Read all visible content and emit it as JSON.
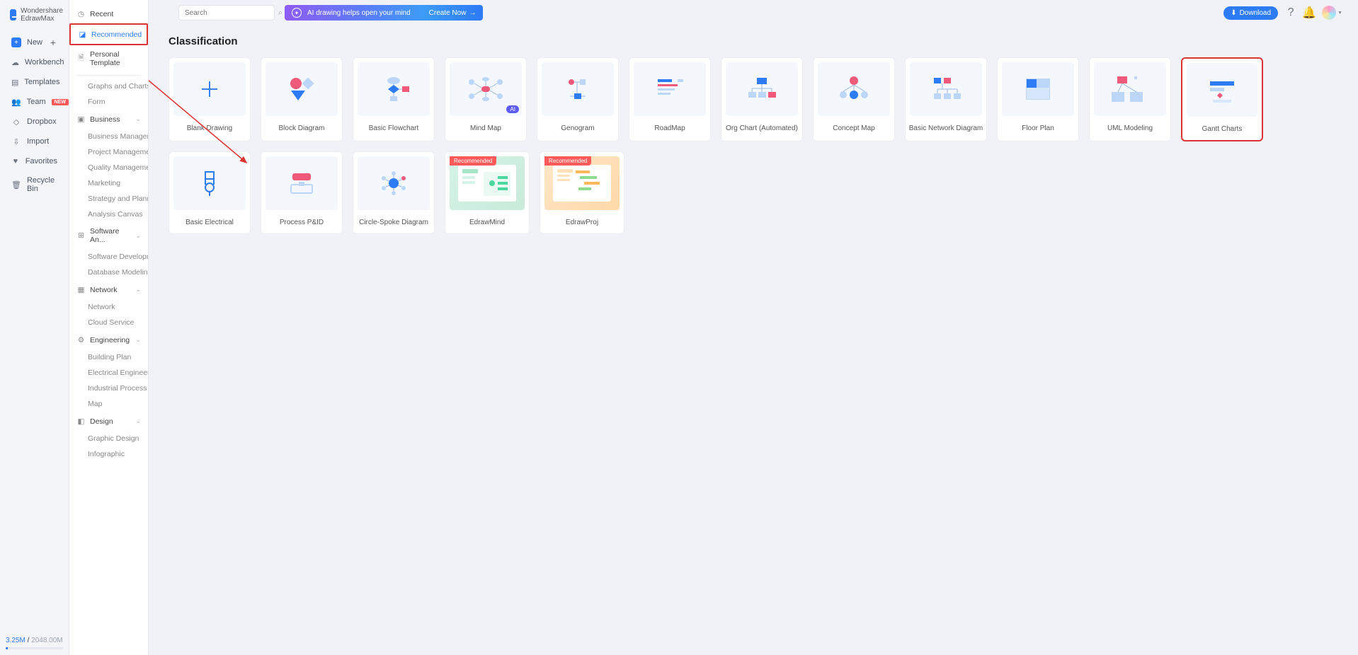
{
  "brand": {
    "line1": "Wondershare",
    "line2": "EdrawMax"
  },
  "leftNav": {
    "new": "New",
    "workbench": "Workbench",
    "templates": "Templates",
    "team": "Team",
    "team_badge": "NEW",
    "dropbox": "Dropbox",
    "import": "Import",
    "favorites": "Favorites",
    "recycle": "Recycle Bin"
  },
  "storage": {
    "used": "3.25M",
    "total_sep": " / ",
    "total": "2048.00M"
  },
  "midNav": {
    "recent": "Recent",
    "recommended": "Recommended",
    "personal": "Personal Template",
    "graphs": "Graphs and Charts",
    "form": "Form",
    "business": "Business",
    "business_sub": [
      "Business Management",
      "Project Management",
      "Quality Management",
      "Marketing",
      "Strategy and Planning",
      "Analysis Canvas"
    ],
    "software": "Software An...",
    "software_sub": [
      "Software Development",
      "Database Modeling"
    ],
    "network": "Network",
    "network_sub": [
      "Network",
      "Cloud Service"
    ],
    "engineering": "Engineering",
    "engineering_sub": [
      "Building Plan",
      "Electrical Engineering",
      "Industrial Process",
      "Map"
    ],
    "design": "Design",
    "design_sub": [
      "Graphic Design",
      "Infographic"
    ]
  },
  "header": {
    "search_placeholder": "Search",
    "ai_text": "AI drawing helps open your mind",
    "ai_create": "Create Now",
    "download": "Download"
  },
  "content": {
    "title": "Classification",
    "cards": [
      {
        "label": "Blank Drawing"
      },
      {
        "label": "Block Diagram"
      },
      {
        "label": "Basic Flowchart"
      },
      {
        "label": "Mind Map",
        "ai": "AI"
      },
      {
        "label": "Genogram"
      },
      {
        "label": "RoadMap"
      },
      {
        "label": "Org Chart (Automated)"
      },
      {
        "label": "Concept Map"
      },
      {
        "label": "Basic Network Diagram"
      },
      {
        "label": "Floor Plan"
      },
      {
        "label": "UML Modeling"
      },
      {
        "label": "Gantt Charts"
      },
      {
        "label": "Basic Electrical"
      },
      {
        "label": "Process P&ID"
      },
      {
        "label": "Circle-Spoke Diagram"
      },
      {
        "label": "EdrawMind",
        "rec": "Recommended"
      },
      {
        "label": "EdrawProj",
        "rec": "Recommended"
      }
    ]
  }
}
